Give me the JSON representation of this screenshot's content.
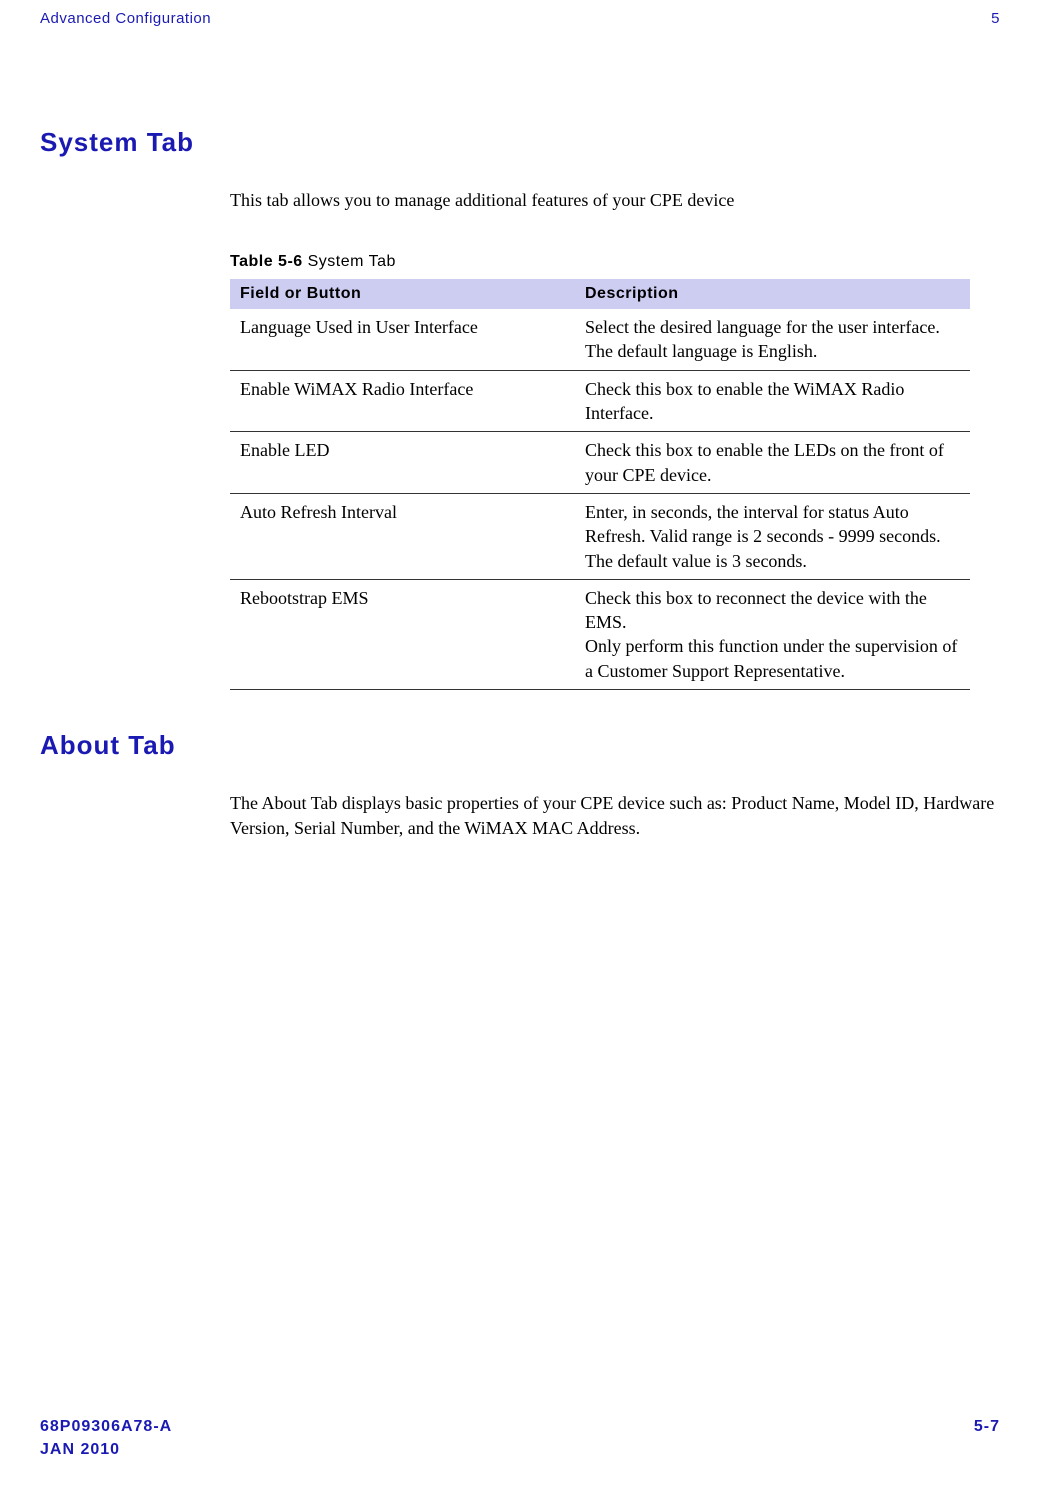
{
  "header": {
    "left": "Advanced Configuration",
    "right": "5"
  },
  "sections": {
    "system": {
      "heading": "System Tab",
      "intro": "This tab allows you to manage additional features of your CPE device",
      "table": {
        "caption_bold": "Table 5-6",
        "caption_rest": " System Tab",
        "headers": {
          "col1": "Field or Button",
          "col2": "Description"
        },
        "rows": [
          {
            "field": "Language Used in User Interface",
            "desc": "Select the desired language for the user interface. The default language is English."
          },
          {
            "field": "Enable WiMAX Radio Interface",
            "desc": "Check this box to enable the WiMAX Radio Interface."
          },
          {
            "field": "Enable LED",
            "desc": "Check this box to enable the LEDs on the front of your CPE device."
          },
          {
            "field": "Auto Refresh Interval",
            "desc": "Enter, in seconds, the interval for status Auto Refresh. Valid range is 2 seconds - 9999 seconds. The default value is 3 seconds."
          },
          {
            "field": "Rebootstrap EMS",
            "desc": "Check this box to reconnect the device with the EMS.\nOnly perform this function under the supervision of a Customer Support Representative."
          }
        ]
      }
    },
    "about": {
      "heading": "About Tab",
      "intro": "The About Tab displays basic properties of your CPE device such as: Product Name, Model ID, Hardware Version, Serial Number, and the WiMAX MAC Address."
    }
  },
  "footer": {
    "left_line1": "68P09306A78-A",
    "left_line2": "JAN 2010",
    "right": "5-7"
  }
}
